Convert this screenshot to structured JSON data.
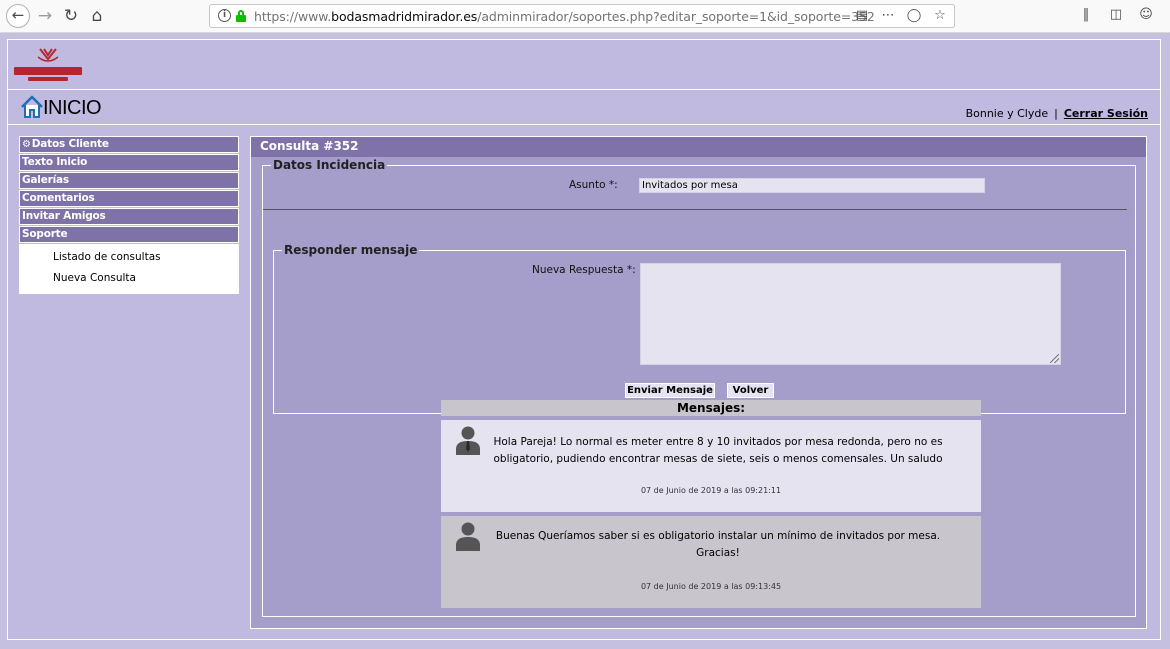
{
  "browser": {
    "url_prefix": "https://www.",
    "url_domain": "bodasmadridmirador.es",
    "url_path": "/adminmirador/soportes.php?editar_soporte=1&id_soporte=352"
  },
  "header": {
    "logo_name": "Mirador de Cuatrovientos",
    "home_label": "INICIO",
    "user_name": "Bonnie y Clyde",
    "separator": "|",
    "logout_label": "Cerrar Sesión"
  },
  "sidebar": {
    "items": [
      {
        "label": "Datos Cliente"
      },
      {
        "label": "Texto Inicio"
      },
      {
        "label": "Galerías"
      },
      {
        "label": "Comentarios"
      },
      {
        "label": "Invitar Amigos"
      },
      {
        "label": "Soporte"
      }
    ],
    "sub_items": [
      {
        "label": "Listado de consultas"
      },
      {
        "label": "Nueva Consulta"
      }
    ]
  },
  "main": {
    "title": "Consulta #352",
    "datos": {
      "legend": "Datos Incidencia",
      "asunto_label": "Asunto *:",
      "asunto_value": "Invitados por mesa"
    },
    "respuesta": {
      "legend": "Responder mensaje",
      "label": "Nueva Respuesta *:",
      "value": "",
      "send_label": "Enviar Mensaje",
      "back_label": "Volver"
    },
    "messages": {
      "heading": "Mensajes:",
      "items": [
        {
          "text": "Hola Pareja! Lo normal es meter entre 8 y 10 invitados por mesa redonda, pero no es obligatorio, pudiendo encontrar mesas de siete, seis o menos comensales. Un saludo",
          "date": "07 de Junio de 2019 a las 09:21:11"
        },
        {
          "text": "Buenas Queríamos saber si es obligatorio instalar un mínimo de invitados por mesa. Gracias!",
          "date": "07 de Junio de 2019 a las 09:13:45"
        }
      ]
    }
  },
  "colors": {
    "page_bg": "#c0b9e0",
    "panel_bg": "#a59dca",
    "menu_bg": "#7e72a8",
    "message_admin_bg": "#e6e3f0",
    "message_client_bg": "#c8c6cc"
  }
}
